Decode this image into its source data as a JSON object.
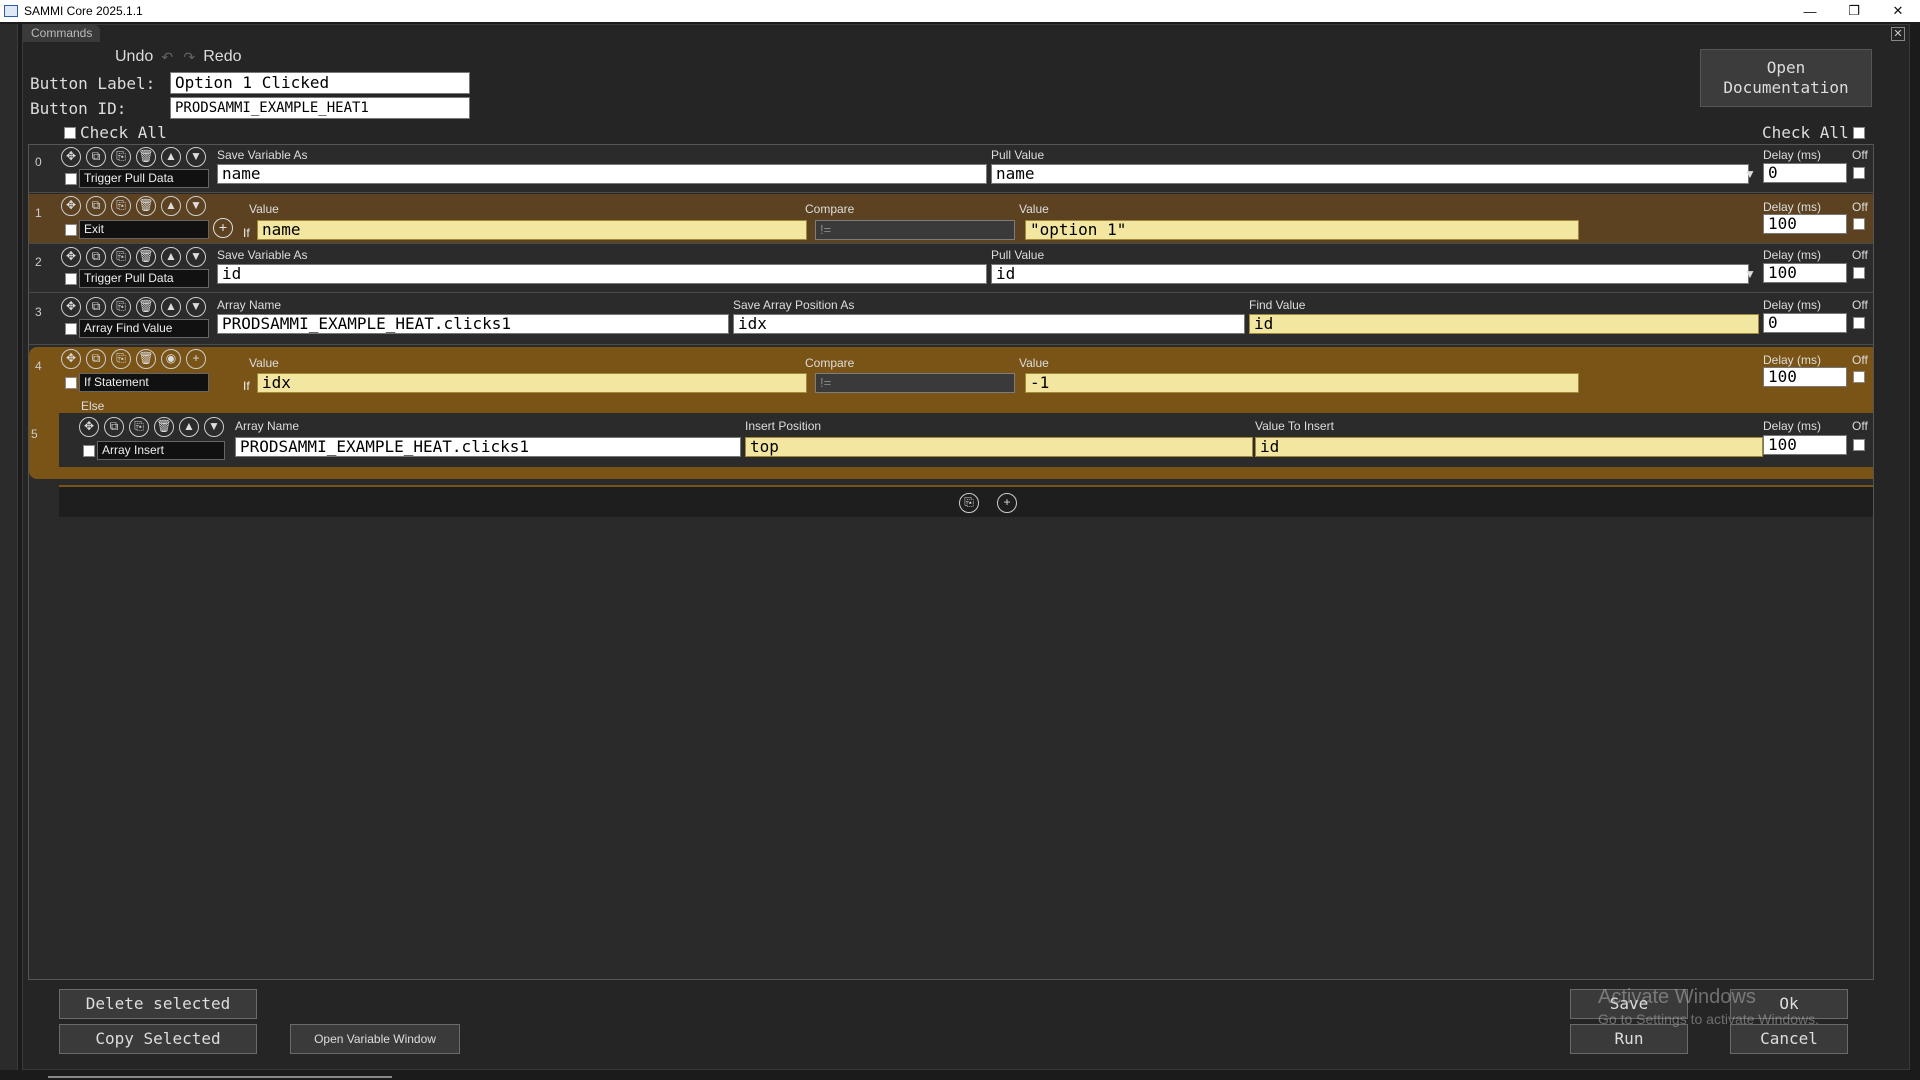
{
  "titlebar": {
    "title": "SAMMI Core 2025.1.1",
    "minimize": "—",
    "maximize": "❐",
    "close": "✕"
  },
  "window": {
    "tab": "Commands",
    "close": "✕"
  },
  "toolbar": {
    "undo": "Undo",
    "redo": "Redo",
    "undo_icon": "↶",
    "redo_icon": "↷"
  },
  "button": {
    "label_caption": "Button Label:",
    "label_value": "Option 1 Clicked",
    "id_caption": "Button ID:",
    "id_value": "PRODSAMMI_EXAMPLE_HEAT1"
  },
  "open_documentation": "Open Documentation",
  "check_all_left": "Check All",
  "check_all_right": "Check All",
  "tool_icons": {
    "move": "✥",
    "copy": "⧉",
    "paste": "⎘",
    "delete": "🗑",
    "up": "▲",
    "down": "▼",
    "eye": "◉",
    "add": "+"
  },
  "commands": [
    {
      "index": "0",
      "name": "Trigger Pull Data",
      "f1_label": "Save Variable As",
      "f1": "name",
      "f2_label": "Pull Value",
      "f2": "name",
      "delay_label": "Delay (ms)",
      "delay": "0",
      "off_label": "Off"
    },
    {
      "index": "1",
      "name": "Exit",
      "if": "If",
      "v1_label": "Value",
      "v1": "name",
      "cmp_label": "Compare",
      "cmp": "!=",
      "v2_label": "Value",
      "v2": "\"option 1\"",
      "delay_label": "Delay (ms)",
      "delay": "100",
      "off_label": "Off"
    },
    {
      "index": "2",
      "name": "Trigger Pull Data",
      "f1_label": "Save Variable As",
      "f1": "id",
      "f2_label": "Pull Value",
      "f2": "id",
      "delay_label": "Delay (ms)",
      "delay": "100",
      "off_label": "Off"
    },
    {
      "index": "3",
      "name": "Array Find Value",
      "f1_label": "Array Name",
      "f1": "PRODSAMMI_EXAMPLE_HEAT.clicks1",
      "f2_label": "Save Array Position As",
      "f2": "idx",
      "f3_label": "Find Value",
      "f3": "id",
      "delay_label": "Delay (ms)",
      "delay": "0",
      "off_label": "Off"
    },
    {
      "index": "4",
      "name": "If Statement",
      "if": "If",
      "v1_label": "Value",
      "v1": "idx",
      "cmp_label": "Compare",
      "cmp": "!=",
      "v2_label": "Value",
      "v2": "-1",
      "delay_label": "Delay (ms)",
      "delay": "100",
      "off_label": "Off",
      "else": "Else"
    },
    {
      "index": "5",
      "name": "Array Insert",
      "f1_label": "Array Name",
      "f1": "PRODSAMMI_EXAMPLE_HEAT.clicks1",
      "f2_label": "Insert Position",
      "f2": "top",
      "f3_label": "Value To Insert",
      "f3": "id",
      "delay_label": "Delay (ms)",
      "delay": "100",
      "off_label": "Off"
    }
  ],
  "footer": {
    "delete_selected": "Delete selected",
    "copy_selected": "Copy Selected",
    "open_variable_window": "Open Variable Window",
    "save": "Save",
    "ok": "Ok",
    "run": "Run",
    "cancel": "Cancel"
  },
  "watermark": {
    "line1": "Activate Windows",
    "line2": "Go to Settings to activate Windows."
  },
  "colors": {
    "brown_row": "#5c4221",
    "if_block": "#7a5416",
    "yellow_field": "#f2e6a0"
  }
}
